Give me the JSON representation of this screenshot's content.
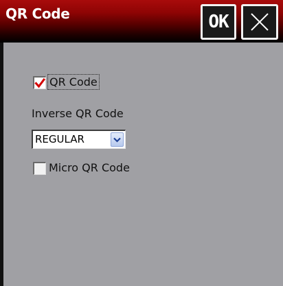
{
  "window": {
    "title": "QR Code",
    "ok_label": "OK",
    "close_icon": "close-icon"
  },
  "form": {
    "qr_code": {
      "label": "QR Code",
      "checked": true
    },
    "inverse": {
      "label": "Inverse QR Code",
      "selected": "REGULAR"
    },
    "micro_qr": {
      "label": "Micro QR Code",
      "checked": false
    }
  },
  "colors": {
    "titlebar_top": "#a80b0b",
    "titlebar_bottom": "#000000",
    "background": "#a0a0a4",
    "checkmark": "#d40000"
  }
}
